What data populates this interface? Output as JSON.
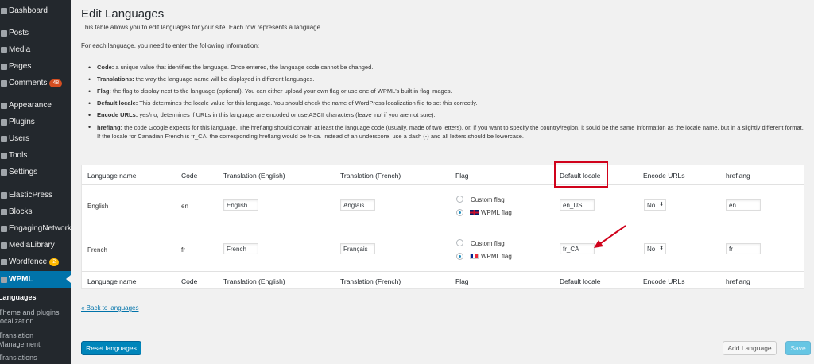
{
  "sidebar": {
    "items": [
      {
        "label": "Dashboard",
        "icon": "dashboard-icon"
      },
      {
        "label": "Posts",
        "icon": "pin-icon"
      },
      {
        "label": "Media",
        "icon": "media-icon"
      },
      {
        "label": "Pages",
        "icon": "pages-icon"
      },
      {
        "label": "Comments",
        "icon": "comment-icon",
        "badge": "48"
      },
      {
        "label": "Appearance",
        "icon": "brush-icon"
      },
      {
        "label": "Plugins",
        "icon": "plugin-icon"
      },
      {
        "label": "Users",
        "icon": "user-icon"
      },
      {
        "label": "Tools",
        "icon": "wrench-icon"
      },
      {
        "label": "Settings",
        "icon": "settings-icon"
      },
      {
        "label": "ElasticPress",
        "icon": "elasticpress-icon"
      },
      {
        "label": "Blocks",
        "icon": "blocks-icon"
      },
      {
        "label": "EngagingNetworks",
        "icon": "en-icon"
      },
      {
        "label": "MediaLibrary",
        "icon": "library-icon"
      },
      {
        "label": "Wordfence",
        "icon": "shield-icon",
        "badge": "2"
      },
      {
        "label": "WPML",
        "icon": "wpml-icon"
      }
    ],
    "submenu": [
      "Languages",
      "Theme and plugins localization",
      "Translation Management",
      "Translations"
    ]
  },
  "page": {
    "title": "Edit Languages",
    "intro": "This table allows you to edit languages for your site. Each row represents a language.",
    "instructions": "For each language, you need to enter the following information:",
    "bullets": [
      {
        "term": "Code:",
        "text": " a unique value that identifies the language. Once entered, the language code cannot be changed."
      },
      {
        "term": "Translations:",
        "text": " the way the language name will be displayed in different languages."
      },
      {
        "term": "Flag:",
        "text": " the flag to display next to the language (optional). You can either upload your own flag or use one of WPML's built in flag images."
      },
      {
        "term": "Default locale:",
        "text": " This determines the locale value for this language. You should check the name of WordPress localization file to set this correctly."
      },
      {
        "term": "Encode URLs:",
        "text": " yes/no, determines if URLs in this language are encoded or use ASCII characters (leave 'no' if you are not sure)."
      },
      {
        "term": "hreflang:",
        "text": " the code Google expects for this language. The hreflang should contain at least the language code (usually, made of two letters), or, if you want to specify the country/region, it sould be the same information as the locale name, but in a slightly different format. If the locale for Canadian French is fr_CA, the corresponding hreflang would be fr-ca. Instead of an underscore, use a dash (-) and all letters should be lowercase."
      }
    ]
  },
  "table": {
    "columns": [
      "Language name",
      "Code",
      "Translation (English)",
      "Translation (French)",
      "Flag",
      "Default locale",
      "Encode URLs",
      "hreflang"
    ],
    "rows": [
      {
        "name": "English",
        "code": "en",
        "tr_en": "English",
        "tr_fr": "Anglais",
        "flag_custom": "Custom flag",
        "flag_wpml": "WPML flag",
        "locale": "en_US",
        "encode": "No",
        "hreflang": "en"
      },
      {
        "name": "French",
        "code": "fr",
        "tr_en": "French",
        "tr_fr": "Français",
        "flag_custom": "Custom flag",
        "flag_wpml": "WPML flag",
        "locale": "fr_CA",
        "encode": "No",
        "hreflang": "fr"
      }
    ]
  },
  "actions": {
    "back_link": "« Back to languages",
    "reset": "Reset languages",
    "add": "Add Language",
    "save": "Save"
  },
  "colors": {
    "accent": "#0073aa",
    "highlight": "#d0021b",
    "sidebar_bg": "#23282d"
  }
}
